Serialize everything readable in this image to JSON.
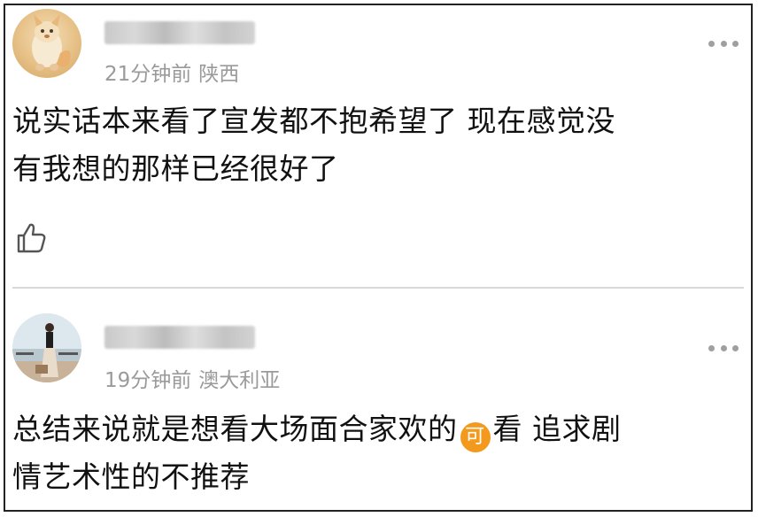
{
  "comments": [
    {
      "time": "21分钟前",
      "location": "陕西",
      "text_lines": [
        "说实话本来看了宣发都不抱希望了 现在感觉没",
        "有我想的那样已经很好了"
      ],
      "avatar_icon": "fox-avatar",
      "more_icon": "more-dots-icon",
      "like_icon": "thumbs-up-icon"
    },
    {
      "time": "19分钟前",
      "location": "澳大利亚",
      "text_line1_before": "总结来说就是想看大场面合家欢的",
      "emoji_char": "可",
      "text_line1_after": "看 追求剧",
      "text_line2": "情艺术性的不推荐",
      "avatar_icon": "person-photo-avatar",
      "more_icon": "more-dots-icon",
      "emoji_color": "#f39a1e"
    }
  ],
  "colors": {
    "meta_text": "#9a9a9a",
    "body_text": "#111111",
    "divider": "#d8d8d8"
  }
}
